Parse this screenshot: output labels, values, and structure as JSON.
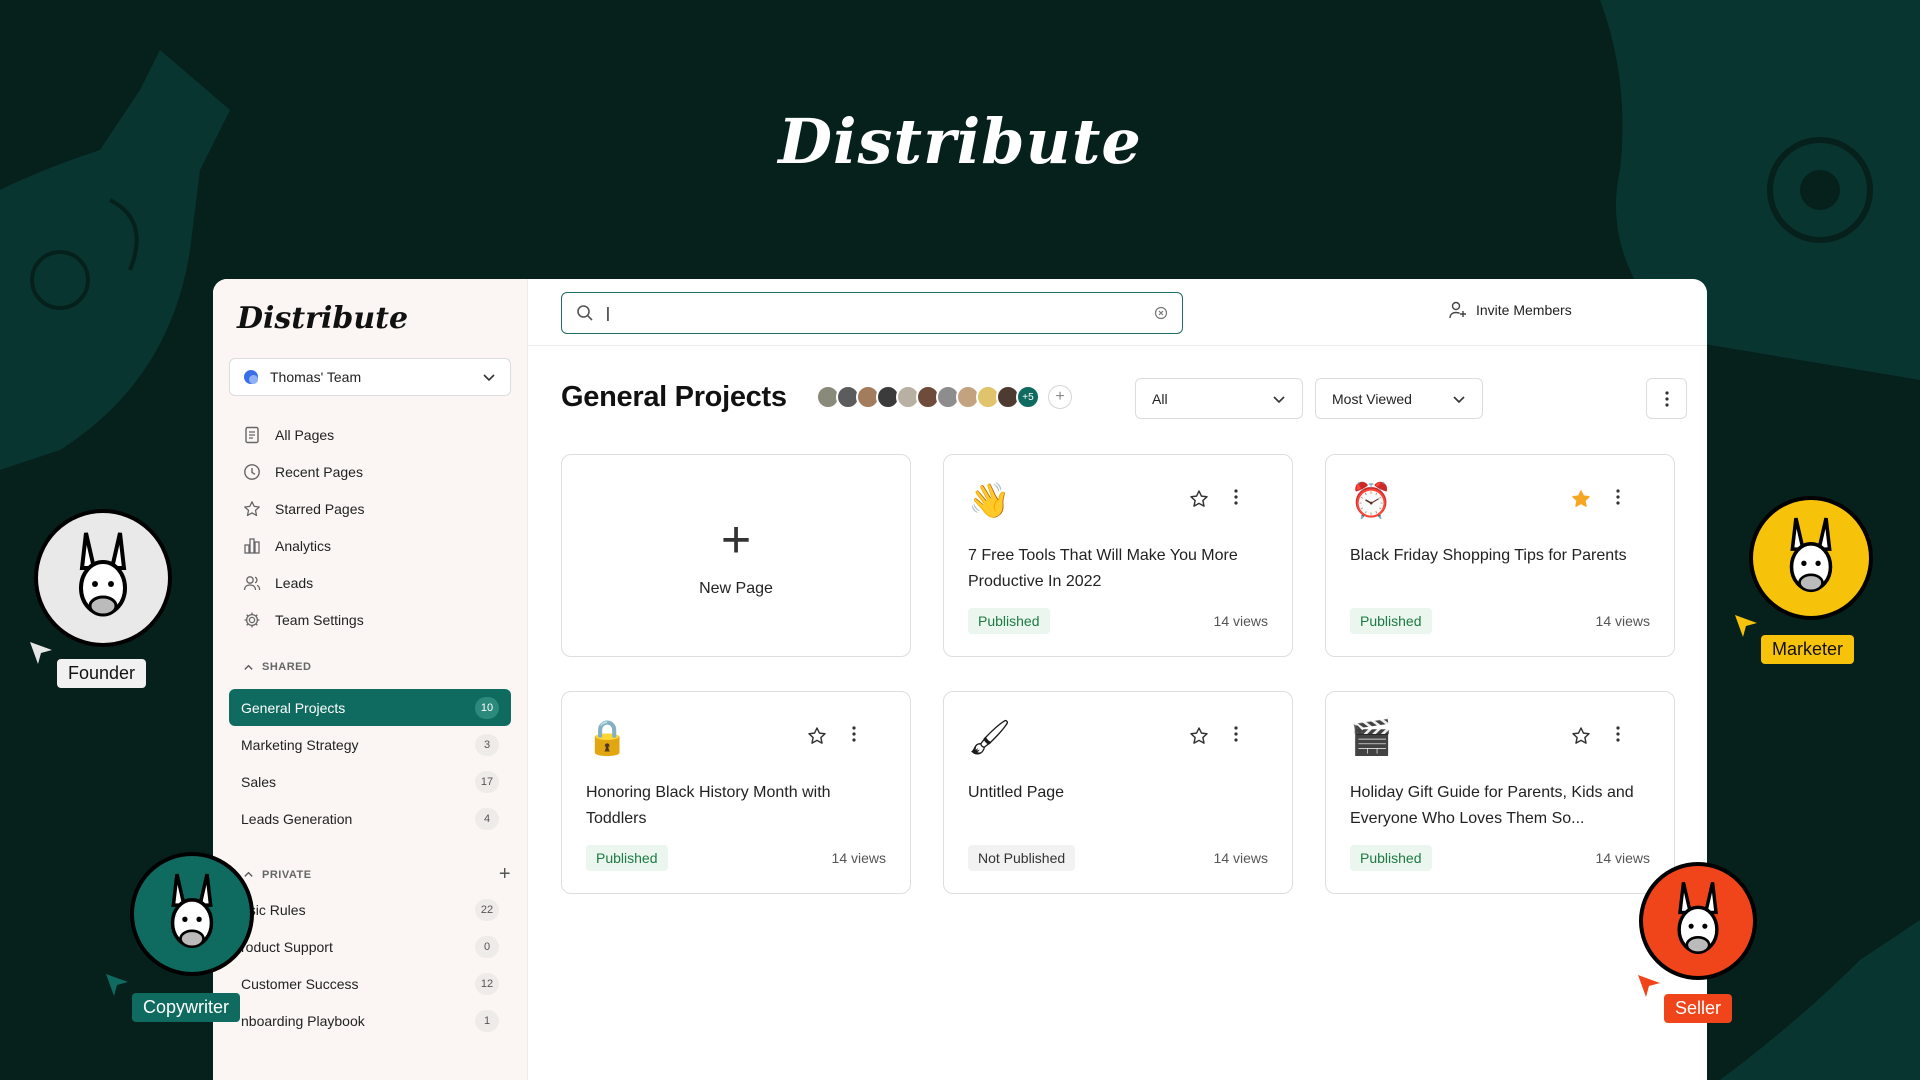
{
  "hero": {
    "title": "Distribute"
  },
  "app": {
    "logo": "Distribute",
    "team": {
      "name": "Thomas' Team"
    },
    "nav": [
      {
        "label": "All Pages",
        "icon": "document-icon"
      },
      {
        "label": "Recent Pages",
        "icon": "clock-icon"
      },
      {
        "label": "Starred Pages",
        "icon": "star-icon"
      },
      {
        "label": "Analytics",
        "icon": "bar-chart-icon"
      },
      {
        "label": "Leads",
        "icon": "users-icon"
      },
      {
        "label": "Team Settings",
        "icon": "gear-icon"
      }
    ],
    "shared": {
      "heading": "SHARED",
      "items": [
        {
          "label": "General Projects",
          "count": "10",
          "active": true
        },
        {
          "label": "Marketing Strategy",
          "count": "3"
        },
        {
          "label": "Sales",
          "count": "17"
        },
        {
          "label": "Leads Generation",
          "count": "4"
        }
      ]
    },
    "private": {
      "heading": "PRIVATE",
      "items": [
        {
          "label": "asic Rules",
          "count": "22"
        },
        {
          "label": "roduct Support",
          "count": "0"
        },
        {
          "label": "Customer Success",
          "count": "12"
        },
        {
          "label": "nboarding Playbook",
          "count": "1"
        }
      ]
    },
    "search": {
      "value": "|",
      "placeholder": ""
    },
    "invite_label": "Invite Members",
    "page_title": "General Projects",
    "members_more": "+5",
    "filters": {
      "status": "All",
      "sort": "Most Viewed"
    },
    "new_page_label": "New Page",
    "cards": [
      {
        "emoji": "👋",
        "title": "7 Free Tools That Will Make You More Productive In 2022",
        "status": "Published",
        "views": "14 views",
        "starred": false
      },
      {
        "emoji": "⏰",
        "title": "Black Friday Shopping Tips for Parents",
        "status": "Published",
        "views": "14 views",
        "starred": true
      },
      {
        "emoji": "🔒",
        "title": "Honoring Black History Month with Toddlers",
        "status": "Published",
        "views": "14 views",
        "starred": false
      },
      {
        "emoji": "🖌",
        "title": "Untitled Page",
        "status": "Not Published",
        "views": "14 views",
        "starred": false
      },
      {
        "emoji": "🎬",
        "title": "Holiday Gift Guide for Parents, Kids and Everyone Who Loves Them So...",
        "status": "Published",
        "views": "14 views",
        "starred": false
      }
    ]
  },
  "personas": [
    {
      "label": "Founder",
      "color": "#e9e9e9"
    },
    {
      "label": "Marketer",
      "color": "#f7c20a"
    },
    {
      "label": "Copywriter",
      "color": "#0f6b5f"
    },
    {
      "label": "Seller",
      "color": "#f0451a"
    }
  ],
  "colors": {
    "brand": "#0f6b5f",
    "background": "#06201c",
    "star": "#f5a623"
  }
}
